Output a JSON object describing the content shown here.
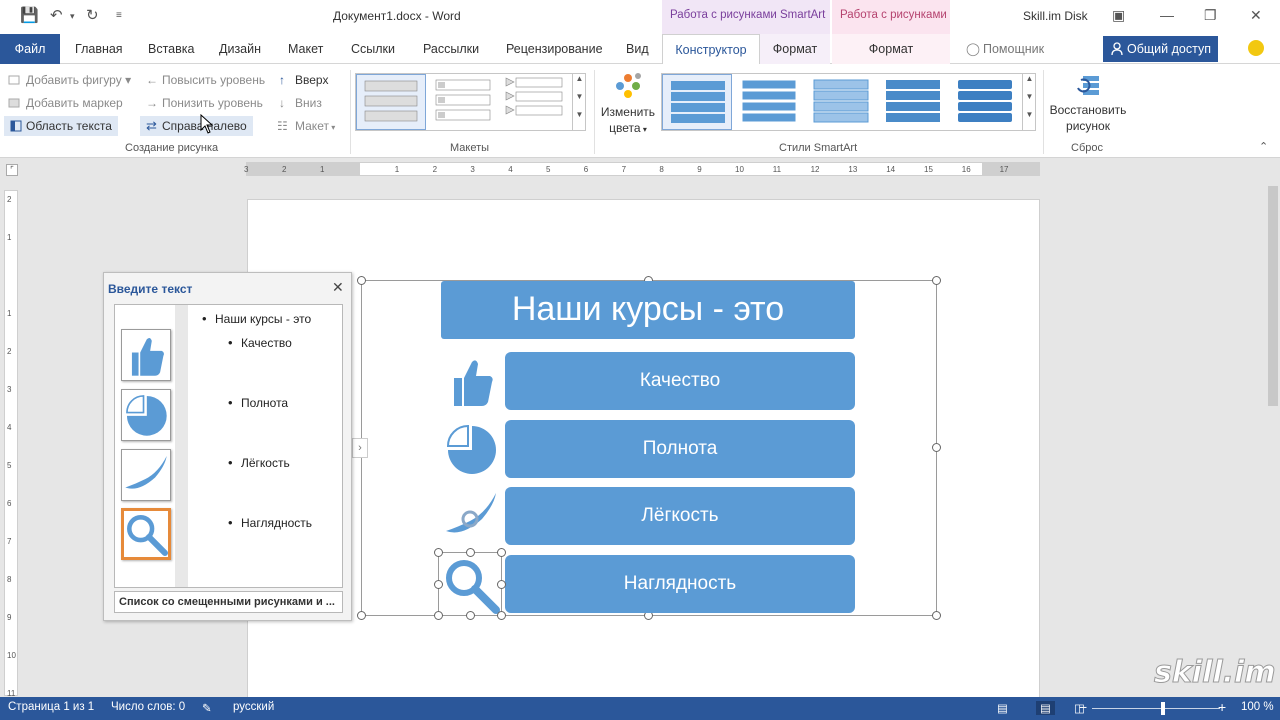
{
  "window": {
    "title": "Документ1.docx - Word",
    "disk": "Skill.im Disk",
    "ctx_smartart": "Работа с рисунками SmartArt",
    "ctx_pictures": "Работа с рисунками"
  },
  "tabs": {
    "file": "Файл",
    "home": "Главная",
    "insert": "Вставка",
    "design": "Дизайн",
    "layout": "Макет",
    "refs": "Ссылки",
    "mailings": "Рассылки",
    "review": "Рецензирование",
    "view": "Вид",
    "constructor": "Конструктор",
    "format1": "Формат",
    "format2": "Формат",
    "tell": "Помощник",
    "share": "Общий доступ"
  },
  "ribbon": {
    "create": {
      "add_shape": "Добавить фигуру",
      "add_bullet": "Добавить маркер",
      "text_pane": "Область текста",
      "promote": "Повысить уровень",
      "demote": "Понизить уровень",
      "rtl": "Справа налево",
      "up": "Вверх",
      "down": "Вниз",
      "layout": "Макет",
      "label": "Создание рисунка"
    },
    "layouts_label": "Макеты",
    "change_colors_1": "Изменить",
    "change_colors_2": "цвета",
    "styles_label": "Стили SmartArt",
    "reset_1": "Восстановить",
    "reset_2": "рисунок",
    "reset_label": "Сброс"
  },
  "textpane": {
    "title": "Введите текст",
    "footer": "Список со смещенными рисунками и ...",
    "items": [
      {
        "text": "Наши курсы - это"
      },
      {
        "text": "Качество"
      },
      {
        "text": "Полнота"
      },
      {
        "text": "Лёгкость"
      },
      {
        "text": "Наглядность"
      }
    ]
  },
  "smartart": {
    "title": "Наши курсы - это",
    "items": [
      "Качество",
      "Полнота",
      "Лёгкость",
      "Наглядность"
    ],
    "color": "#5b9bd5"
  },
  "ruler": {
    "h": [
      "3",
      "2",
      "1",
      "1",
      "2",
      "3",
      "4",
      "5",
      "6",
      "7",
      "8",
      "9",
      "10",
      "11",
      "12",
      "13",
      "14",
      "15",
      "16",
      "17"
    ],
    "v": [
      "2",
      "1",
      "1",
      "2",
      "3",
      "4",
      "5",
      "6",
      "7",
      "8",
      "9",
      "10",
      "11"
    ]
  },
  "status": {
    "page": "Страница 1 из 1",
    "words": "Число слов: 0",
    "lang": "русский",
    "zoom": "100 %"
  },
  "watermark": "skill.im"
}
